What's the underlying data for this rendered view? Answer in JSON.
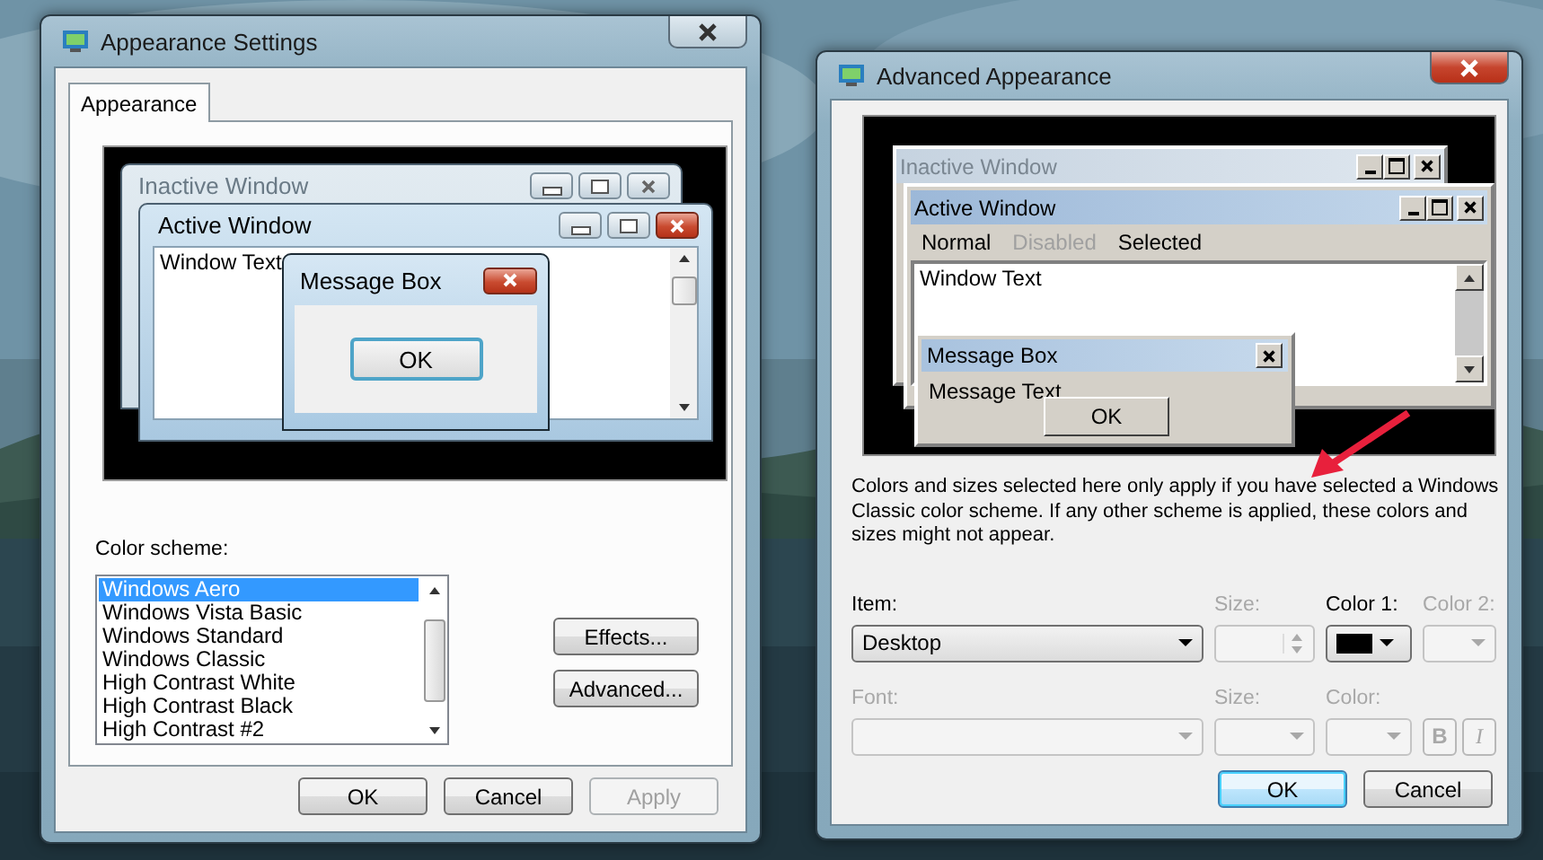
{
  "appearance_settings": {
    "title": "Appearance Settings",
    "tabs": [
      {
        "label": "Appearance",
        "selected": true
      }
    ],
    "preview": {
      "inactive_title": "Inactive Window",
      "active_title": "Active Window",
      "window_text": "Window Text",
      "message_box_title": "Message Box",
      "ok_label": "OK"
    },
    "color_scheme": {
      "label": "Color scheme:",
      "items": [
        {
          "label": "Windows Aero",
          "selected": true
        },
        {
          "label": "Windows Vista Basic",
          "selected": false
        },
        {
          "label": "Windows Standard",
          "selected": false
        },
        {
          "label": "Windows Classic",
          "selected": false
        },
        {
          "label": "High Contrast White",
          "selected": false
        },
        {
          "label": "High Contrast Black",
          "selected": false
        },
        {
          "label": "High Contrast #2",
          "selected": false
        }
      ]
    },
    "side_buttons": [
      "Effects...",
      "Advanced..."
    ],
    "buttons": [
      {
        "label": "OK",
        "disabled": false
      },
      {
        "label": "Cancel",
        "disabled": false
      },
      {
        "label": "Apply",
        "disabled": true
      }
    ]
  },
  "advanced_appearance": {
    "title": "Advanced Appearance",
    "preview": {
      "inactive_title": "Inactive Window",
      "active_title": "Active Window",
      "menu": [
        {
          "label": "Normal",
          "disabled": false
        },
        {
          "label": "Disabled",
          "disabled": true
        },
        {
          "label": "Selected",
          "disabled": false
        }
      ],
      "window_text": "Window Text",
      "message_box_title": "Message Box",
      "message_text": "Message Text",
      "ok_label": "OK"
    },
    "note": "Colors and sizes selected here only apply if you have selected a Windows Classic color scheme. If any other scheme is applied, these colors and sizes might not appear.",
    "item": {
      "label": "Item:",
      "value": "Desktop"
    },
    "item_size": {
      "label": "Size:",
      "disabled": true
    },
    "color_1": {
      "label": "Color 1:",
      "disabled": false,
      "color": "#000000"
    },
    "color_2": {
      "label": "Color 2:",
      "disabled": true
    },
    "font": {
      "label": "Font:",
      "disabled": true
    },
    "font_size": {
      "label": "Size:",
      "disabled": true
    },
    "font_color": {
      "label": "Color:",
      "disabled": true
    },
    "style_buttons": [
      {
        "label": "B",
        "disabled": true
      },
      {
        "label": "I",
        "disabled": true
      }
    ],
    "buttons": [
      {
        "label": "OK",
        "default": true
      },
      {
        "label": "Cancel",
        "default": false
      }
    ]
  }
}
